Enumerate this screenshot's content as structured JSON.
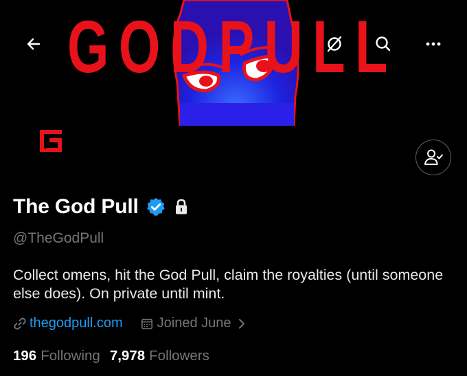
{
  "banner": {
    "text": "GODPULL"
  },
  "navigation": {
    "back_icon": "arrow-left-icon",
    "grok_icon": "grok-icon",
    "search_icon": "search-icon",
    "more_icon": "more-horizontal-icon"
  },
  "profile": {
    "avatar_letter": "G",
    "display_name": "The God Pull",
    "verified_icon": "verified-badge-icon",
    "protected_icon": "lock-icon",
    "handle": "@TheGodPull",
    "bio": "Collect omens, hit the God Pull, claim the royalties (until someone else does). On private until mint.",
    "website": "thegodpull.com",
    "joined": "Joined June",
    "following_count": "196",
    "following_label": "Following",
    "followers_count": "7,978",
    "followers_label": "Followers",
    "follow_request_icon": "person-check-icon"
  },
  "colors": {
    "background": "#000000",
    "accent": "#1d9bf0",
    "banner_red": "#e8121a",
    "secondary_text": "#71767b"
  }
}
